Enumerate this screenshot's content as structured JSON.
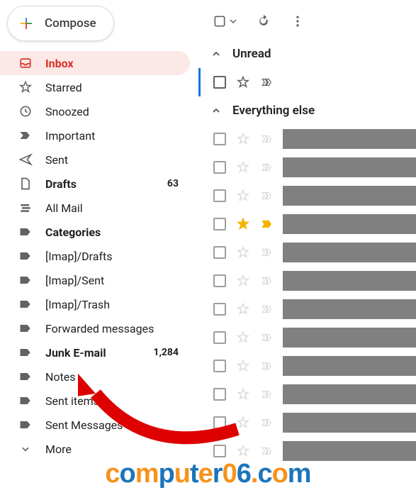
{
  "compose": {
    "label": "Compose"
  },
  "sidebar": {
    "items": [
      {
        "id": "inbox",
        "label": "Inbox",
        "icon": "inbox",
        "active": true,
        "bold": true,
        "count": ""
      },
      {
        "id": "starred",
        "label": "Starred",
        "icon": "star",
        "count": ""
      },
      {
        "id": "snoozed",
        "label": "Snoozed",
        "icon": "clock",
        "count": ""
      },
      {
        "id": "important",
        "label": "Important",
        "icon": "important",
        "count": ""
      },
      {
        "id": "sent",
        "label": "Sent",
        "icon": "send",
        "count": ""
      },
      {
        "id": "drafts",
        "label": "Drafts",
        "icon": "file",
        "bold": true,
        "count": "63"
      },
      {
        "id": "allmail",
        "label": "All Mail",
        "icon": "stack",
        "count": ""
      },
      {
        "id": "categories",
        "label": "Categories",
        "icon": "label",
        "bold": true,
        "count": ""
      },
      {
        "id": "imap-drafts",
        "label": "[Imap]/Drafts",
        "icon": "label",
        "count": ""
      },
      {
        "id": "imap-sent",
        "label": "[Imap]/Sent",
        "icon": "label",
        "count": ""
      },
      {
        "id": "imap-trash",
        "label": "[Imap]/Trash",
        "icon": "label",
        "count": ""
      },
      {
        "id": "forwarded",
        "label": "Forwarded messages",
        "icon": "label",
        "count": ""
      },
      {
        "id": "junk",
        "label": "Junk E-mail",
        "icon": "label",
        "bold": true,
        "count": "1,284"
      },
      {
        "id": "notes",
        "label": "Notes",
        "icon": "label",
        "count": ""
      },
      {
        "id": "sentitems",
        "label": "Sent items",
        "icon": "label",
        "count": ""
      },
      {
        "id": "sentmsgs",
        "label": "Sent Messages",
        "icon": "label",
        "count": ""
      },
      {
        "id": "more",
        "label": "More",
        "icon": "chevron",
        "count": ""
      }
    ]
  },
  "sections": {
    "unread": {
      "label": "Unread"
    },
    "else": {
      "label": "Everything else"
    }
  },
  "unread_rows": [
    {
      "checked": false,
      "star": "off",
      "important": "off-dark"
    }
  ],
  "else_rows": [
    {
      "star": "off",
      "important": "off"
    },
    {
      "star": "off",
      "important": "off"
    },
    {
      "star": "off",
      "important": "off"
    },
    {
      "star": "gold",
      "important": "gold"
    },
    {
      "star": "off",
      "important": "off"
    },
    {
      "star": "off",
      "important": "off"
    },
    {
      "star": "off",
      "important": "off"
    },
    {
      "star": "off",
      "important": "off"
    },
    {
      "star": "off",
      "important": "off"
    },
    {
      "star": "off",
      "important": "off"
    },
    {
      "star": "off",
      "important": "off"
    },
    {
      "star": "off",
      "important": "off"
    }
  ],
  "watermark": {
    "text": "computer06.com"
  }
}
